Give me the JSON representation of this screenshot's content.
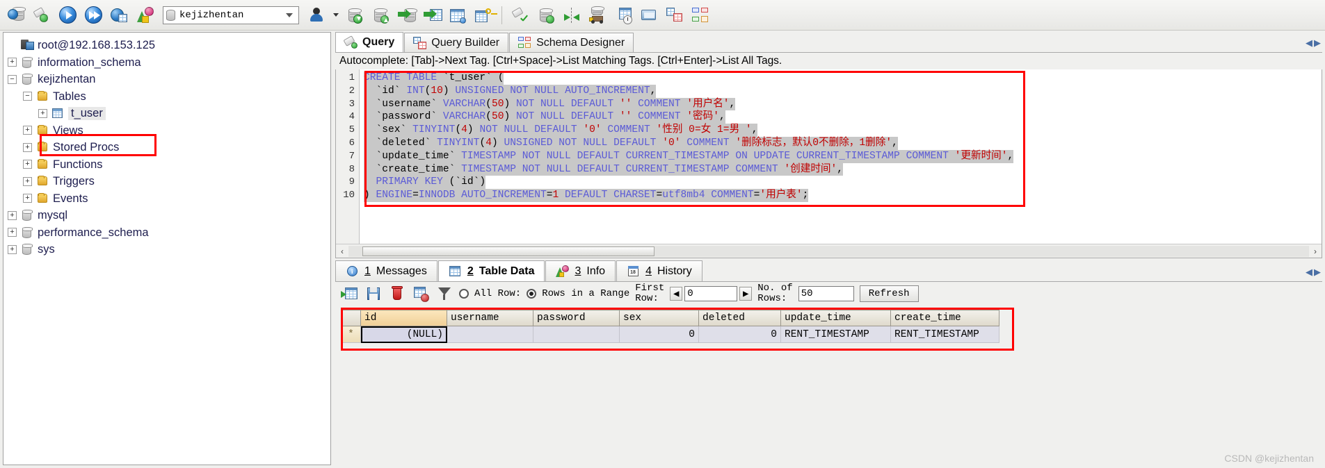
{
  "toolbar": {
    "db_select": {
      "value": "kejizhentan",
      "icon": "database-icon"
    },
    "user_select": {
      "value": "",
      "icon": "user-icon"
    },
    "buttons": [
      {
        "name": "connection-manager-icon",
        "title": "Connection Manager"
      },
      {
        "name": "new-query-icon",
        "title": "New Query"
      },
      {
        "name": "execute-icon",
        "title": "Execute"
      },
      {
        "name": "execute-all-icon",
        "title": "Execute All"
      },
      {
        "name": "execute-script-icon",
        "title": "Execute Script"
      },
      {
        "name": "refresh-objects-icon",
        "title": "Refresh"
      },
      {
        "name": "backup-database-icon",
        "title": "Backup Database"
      },
      {
        "name": "restore-database-icon",
        "title": "Restore Database"
      },
      {
        "name": "import-data-icon",
        "title": "Import Data"
      },
      {
        "name": "export-data-icon",
        "title": "Export Data"
      },
      {
        "name": "table-data-icon",
        "title": "Table Data"
      },
      {
        "name": "user-manager-icon",
        "title": "User Manager"
      },
      {
        "name": "design-table-icon",
        "title": "Design Table"
      },
      {
        "name": "sync-database-icon",
        "title": "Synchronize Database"
      },
      {
        "name": "compare-schema-icon",
        "title": "Compare Schema"
      },
      {
        "name": "data-transfer-icon",
        "title": "Data Transfer"
      },
      {
        "name": "scheduler-icon",
        "title": "Scheduler"
      },
      {
        "name": "server-monitor-icon",
        "title": "Server Monitor"
      },
      {
        "name": "query-builder-icon",
        "title": "Query Builder"
      },
      {
        "name": "schema-designer-icon",
        "title": "Schema Designer"
      }
    ]
  },
  "tree": {
    "root": {
      "label": "root@192.168.153.125",
      "icon": "server-icon"
    },
    "nodes": [
      {
        "label": "information_schema",
        "icon": "database-icon",
        "expander": "+",
        "level": 1
      },
      {
        "label": "kejizhentan",
        "icon": "database-icon",
        "expander": "−",
        "level": 1
      },
      {
        "label": "Tables",
        "icon": "folder-icon",
        "expander": "−",
        "level": 2
      },
      {
        "label": "t_user",
        "icon": "table-icon",
        "expander": "+",
        "level": 3,
        "selected": true,
        "highlighted": true
      },
      {
        "label": "Views",
        "icon": "folder-icon",
        "expander": "+",
        "level": 2
      },
      {
        "label": "Stored Procs",
        "icon": "folder-icon",
        "expander": "+",
        "level": 2
      },
      {
        "label": "Functions",
        "icon": "folder-icon",
        "expander": "+",
        "level": 2
      },
      {
        "label": "Triggers",
        "icon": "folder-icon",
        "expander": "+",
        "level": 2
      },
      {
        "label": "Events",
        "icon": "folder-icon",
        "expander": "+",
        "level": 2
      },
      {
        "label": "mysql",
        "icon": "database-icon",
        "expander": "+",
        "level": 1
      },
      {
        "label": "performance_schema",
        "icon": "database-icon",
        "expander": "+",
        "level": 1
      },
      {
        "label": "sys",
        "icon": "database-icon",
        "expander": "+",
        "level": 1
      }
    ]
  },
  "editor_tabs": [
    {
      "label": "Query",
      "icon": "query-icon",
      "active": true
    },
    {
      "label": "Query Builder",
      "icon": "query-builder-icon",
      "active": false
    },
    {
      "label": "Schema Designer",
      "icon": "schema-designer-icon",
      "active": false
    }
  ],
  "hint": "Autocomplete: [Tab]->Next Tag. [Ctrl+Space]->List Matching Tags. [Ctrl+Enter]->List All Tags.",
  "code": {
    "line_numbers": [
      "1",
      "2",
      "3",
      "4",
      "5",
      "6",
      "7",
      "8",
      "9",
      "10"
    ],
    "lines": [
      "CREATE TABLE `t_user` (",
      "  `id` INT(10) UNSIGNED NOT NULL AUTO_INCREMENT,",
      "  `username` VARCHAR(50) NOT NULL DEFAULT '' COMMENT '用户名',",
      "  `password` VARCHAR(50) NOT NULL DEFAULT '' COMMENT '密码',",
      "  `sex` TINYINT(4) NOT NULL DEFAULT '0' COMMENT '性别 0=女 1=男 ',",
      "  `deleted` TINYINT(4) UNSIGNED NOT NULL DEFAULT '0' COMMENT '删除标志，默认0不删除，1删除',",
      "  `update_time` TIMESTAMP NOT NULL DEFAULT CURRENT_TIMESTAMP ON UPDATE CURRENT_TIMESTAMP COMMENT '更新时间',",
      "  `create_time` TIMESTAMP NOT NULL DEFAULT CURRENT_TIMESTAMP COMMENT '创建时间',",
      "  PRIMARY KEY (`id`)",
      ") ENGINE=INNODB AUTO_INCREMENT=1 DEFAULT CHARSET=utf8mb4 COMMENT='用户表';"
    ]
  },
  "result_tabs": [
    {
      "num": "1",
      "label": "Messages",
      "icon": "info-icon",
      "active": false
    },
    {
      "num": "2",
      "label": "Table Data",
      "icon": "table-icon",
      "active": true
    },
    {
      "num": "3",
      "label": "Info",
      "icon": "chart-icon",
      "active": false
    },
    {
      "num": "4",
      "label": "History",
      "icon": "calendar-icon",
      "active": false
    }
  ],
  "data_toolbar": {
    "icons": [
      {
        "name": "add-row-icon"
      },
      {
        "name": "save-row-icon"
      },
      {
        "name": "delete-row-icon"
      },
      {
        "name": "cancel-edit-icon"
      },
      {
        "name": "filter-icon"
      }
    ],
    "all_rows_label": "All Row:",
    "range_label": "Rows in a Range",
    "first_row_label_1": "First",
    "first_row_label_2": "Row:",
    "first_row_value": "0",
    "no_of_rows_label_1": "No. of",
    "no_of_rows_label_2": "Rows:",
    "no_of_rows_value": "50",
    "refresh_label": "Refresh",
    "all_rows_selected": false,
    "range_selected": true
  },
  "grid": {
    "columns": [
      "",
      "id",
      "username",
      "password",
      "sex",
      "deleted",
      "update_time",
      "create_time"
    ],
    "rows": [
      {
        "marker": "*",
        "id": "(NULL)",
        "username": "",
        "password": "",
        "sex": "0",
        "deleted": "0",
        "update_time": "RENT_TIMESTAMP",
        "create_time": "RENT_TIMESTAMP"
      }
    ]
  },
  "watermark": "CSDN @kejizhentan",
  "colors": {
    "highlight_box": "#ff0000",
    "keyword": "#5b5bd6",
    "literal": "#c00000",
    "code_bg": "#c8c8c8",
    "tree_text": "#1d1d4e"
  }
}
